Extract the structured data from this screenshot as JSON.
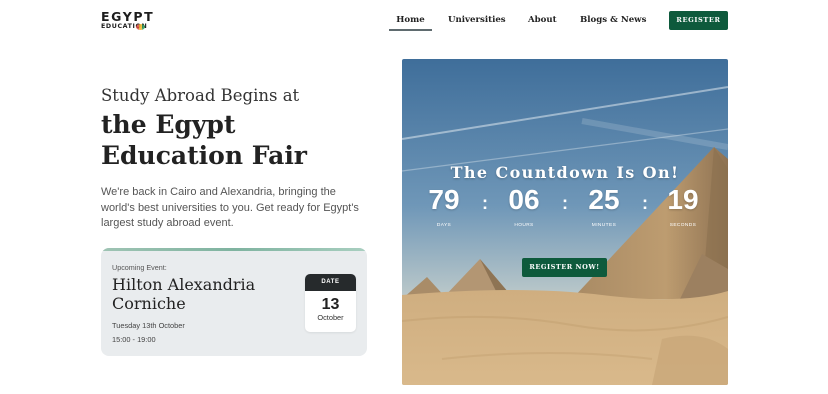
{
  "header": {
    "logo_top": "EGYPT",
    "logo_bottom": "EDUCATION",
    "nav": [
      "Home",
      "Universities",
      "About",
      "Blogs & News"
    ],
    "register_label": "REGISTER"
  },
  "hero": {
    "pretitle": "Study Abroad Begins at",
    "title": "the Egypt Education Fair",
    "description": "We're back in Cairo and Alexandria, bringing the world's best universities to you. Get ready for Egypt's largest study abroad event."
  },
  "event": {
    "label": "Upcoming Event:",
    "name": "Hilton Alexandria Corniche",
    "date_text": "Tuesday 13th October",
    "time": "15:00 - 19:00",
    "badge": {
      "head": "DATE",
      "day": "13",
      "month": "October"
    }
  },
  "countdown": {
    "title": "The Countdown Is On!",
    "units": [
      {
        "value": "79",
        "label": "DAYS"
      },
      {
        "value": "06",
        "label": "HOURS"
      },
      {
        "value": "25",
        "label": "MINUTES"
      },
      {
        "value": "19",
        "label": "SECONDS"
      }
    ],
    "separator": ":",
    "button_label": "REGISTER NOW!"
  },
  "colors": {
    "brand_green": "#0e5a3c",
    "dark": "#262a2c",
    "card_bg": "#e9ecee"
  }
}
